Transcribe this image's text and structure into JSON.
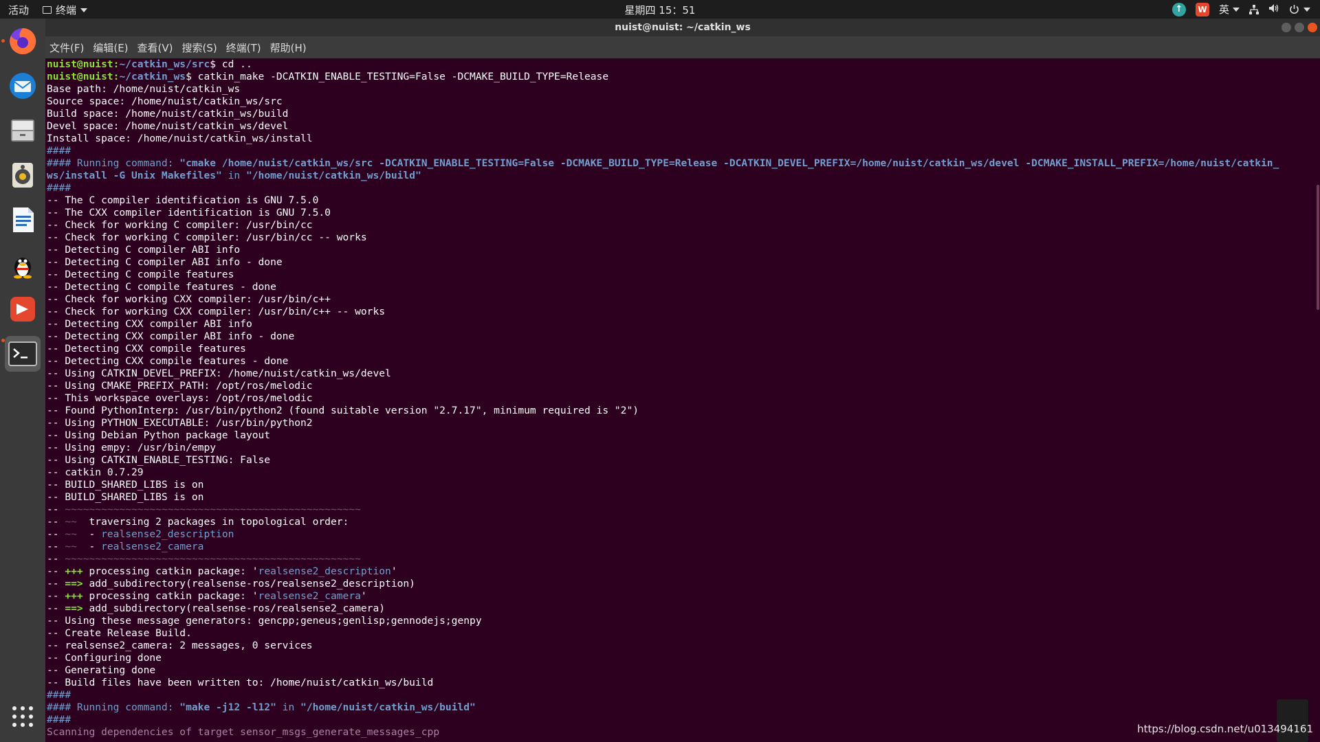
{
  "topbar": {
    "activities": "活动",
    "app_name": "终端",
    "clock": "星期四 15：51",
    "input_method": "英"
  },
  "window": {
    "title": "nuist@nuist: ~/catkin_ws"
  },
  "menu": [
    "文件(F)",
    "编辑(E)",
    "查看(V)",
    "搜索(S)",
    "终端(T)",
    "帮助(H)"
  ],
  "dock": {
    "items": [
      "firefox-icon",
      "thunderbird-icon",
      "files-icon",
      "rhythmbox-icon",
      "libreoffice-writer-icon",
      "qq-icon",
      "wps-icon",
      "terminal-icon"
    ],
    "show_apps": "show-applications-icon"
  },
  "terminal": {
    "lines": [
      [
        {
          "t": "nuist@nuist:",
          "c": "g"
        },
        {
          "t": "~/catkin_ws/src",
          "c": "b"
        },
        {
          "t": "$ cd ..",
          "c": ""
        }
      ],
      [
        {
          "t": "nuist@nuist:",
          "c": "g"
        },
        {
          "t": "~/catkin_ws",
          "c": "b"
        },
        {
          "t": "$ catkin_make -DCATKIN_ENABLE_TESTING=False -DCMAKE_BUILD_TYPE=Release",
          "c": ""
        }
      ],
      [
        {
          "t": "Base path: /home/nuist/catkin_ws",
          "c": ""
        }
      ],
      [
        {
          "t": "Source space: /home/nuist/catkin_ws/src",
          "c": ""
        }
      ],
      [
        {
          "t": "Build space: /home/nuist/catkin_ws/build",
          "c": ""
        }
      ],
      [
        {
          "t": "Devel space: /home/nuist/catkin_ws/devel",
          "c": ""
        }
      ],
      [
        {
          "t": "Install space: /home/nuist/catkin_ws/install",
          "c": ""
        }
      ],
      [
        {
          "t": "####",
          "c": "bp"
        }
      ],
      [
        {
          "t": "#### Running command: ",
          "c": "bp"
        },
        {
          "t": "\"cmake /home/nuist/catkin_ws/src -DCATKIN_ENABLE_TESTING=False -DCMAKE_BUILD_TYPE=Release -DCATKIN_DEVEL_PREFIX=/home/nuist/catkin_ws/devel -DCMAKE_INSTALL_PREFIX=/home/nuist/catkin_",
          "c": "bb"
        }
      ],
      [
        {
          "t": "ws/install -G Unix Makefiles\"",
          "c": "bb"
        },
        {
          "t": " in ",
          "c": "bp"
        },
        {
          "t": "\"/home/nuist/catkin_ws/build\"",
          "c": "bb"
        }
      ],
      [
        {
          "t": "####",
          "c": "bp"
        }
      ],
      [
        {
          "t": "-- The C compiler identification is GNU 7.5.0",
          "c": ""
        }
      ],
      [
        {
          "t": "-- The CXX compiler identification is GNU 7.5.0",
          "c": ""
        }
      ],
      [
        {
          "t": "-- Check for working C compiler: /usr/bin/cc",
          "c": ""
        }
      ],
      [
        {
          "t": "-- Check for working C compiler: /usr/bin/cc -- works",
          "c": ""
        }
      ],
      [
        {
          "t": "-- Detecting C compiler ABI info",
          "c": ""
        }
      ],
      [
        {
          "t": "-- Detecting C compiler ABI info - done",
          "c": ""
        }
      ],
      [
        {
          "t": "-- Detecting C compile features",
          "c": ""
        }
      ],
      [
        {
          "t": "-- Detecting C compile features - done",
          "c": ""
        }
      ],
      [
        {
          "t": "-- Check for working CXX compiler: /usr/bin/c++",
          "c": ""
        }
      ],
      [
        {
          "t": "-- Check for working CXX compiler: /usr/bin/c++ -- works",
          "c": ""
        }
      ],
      [
        {
          "t": "-- Detecting CXX compiler ABI info",
          "c": ""
        }
      ],
      [
        {
          "t": "-- Detecting CXX compiler ABI info - done",
          "c": ""
        }
      ],
      [
        {
          "t": "-- Detecting CXX compile features",
          "c": ""
        }
      ],
      [
        {
          "t": "-- Detecting CXX compile features - done",
          "c": ""
        }
      ],
      [
        {
          "t": "-- Using CATKIN_DEVEL_PREFIX: /home/nuist/catkin_ws/devel",
          "c": ""
        }
      ],
      [
        {
          "t": "-- Using CMAKE_PREFIX_PATH: /opt/ros/melodic",
          "c": ""
        }
      ],
      [
        {
          "t": "-- This workspace overlays: /opt/ros/melodic",
          "c": ""
        }
      ],
      [
        {
          "t": "-- Found PythonInterp: /usr/bin/python2 (found suitable version \"2.7.17\", minimum required is \"2\")",
          "c": ""
        }
      ],
      [
        {
          "t": "-- Using PYTHON_EXECUTABLE: /usr/bin/python2",
          "c": ""
        }
      ],
      [
        {
          "t": "-- Using Debian Python package layout",
          "c": ""
        }
      ],
      [
        {
          "t": "-- Using empy: /usr/bin/empy",
          "c": ""
        }
      ],
      [
        {
          "t": "-- Using CATKIN_ENABLE_TESTING: False",
          "c": ""
        }
      ],
      [
        {
          "t": "-- catkin 0.7.29",
          "c": ""
        }
      ],
      [
        {
          "t": "-- BUILD_SHARED_LIBS is on",
          "c": ""
        }
      ],
      [
        {
          "t": "-- BUILD_SHARED_LIBS is on",
          "c": ""
        }
      ],
      [
        {
          "t": "-- ",
          "c": ""
        },
        {
          "t": "~~~~~~~~~~~~~~~~~~~~~~~~~~~~~~~~~~~~~~~~~~~~~~~~~",
          "c": "gy"
        }
      ],
      [
        {
          "t": "-- ",
          "c": ""
        },
        {
          "t": "~~",
          "c": "gy"
        },
        {
          "t": "  traversing 2 packages in topological order:",
          "c": ""
        }
      ],
      [
        {
          "t": "-- ",
          "c": ""
        },
        {
          "t": "~~",
          "c": "gy"
        },
        {
          "t": "  - ",
          "c": ""
        },
        {
          "t": "realsense2_description",
          "c": "bp"
        }
      ],
      [
        {
          "t": "-- ",
          "c": ""
        },
        {
          "t": "~~",
          "c": "gy"
        },
        {
          "t": "  - ",
          "c": ""
        },
        {
          "t": "realsense2_camera",
          "c": "bp"
        }
      ],
      [
        {
          "t": "-- ",
          "c": ""
        },
        {
          "t": "~~~~~~~~~~~~~~~~~~~~~~~~~~~~~~~~~~~~~~~~~~~~~~~~~",
          "c": "gy"
        }
      ],
      [
        {
          "t": "-- ",
          "c": ""
        },
        {
          "t": "+++",
          "c": "g"
        },
        {
          "t": " processing catkin package: '",
          "c": ""
        },
        {
          "t": "realsense2_description",
          "c": "bp"
        },
        {
          "t": "'",
          "c": ""
        }
      ],
      [
        {
          "t": "-- ",
          "c": ""
        },
        {
          "t": "==>",
          "c": "g"
        },
        {
          "t": " add_subdirectory(realsense-ros/realsense2_description)",
          "c": ""
        }
      ],
      [
        {
          "t": "-- ",
          "c": ""
        },
        {
          "t": "+++",
          "c": "g"
        },
        {
          "t": " processing catkin package: '",
          "c": ""
        },
        {
          "t": "realsense2_camera",
          "c": "bp"
        },
        {
          "t": "'",
          "c": ""
        }
      ],
      [
        {
          "t": "-- ",
          "c": ""
        },
        {
          "t": "==>",
          "c": "g"
        },
        {
          "t": " add_subdirectory(realsense-ros/realsense2_camera)",
          "c": ""
        }
      ],
      [
        {
          "t": "-- Using these message generators: gencpp;geneus;genlisp;gennodejs;genpy",
          "c": ""
        }
      ],
      [
        {
          "t": "-- Create Release Build.",
          "c": ""
        }
      ],
      [
        {
          "t": "-- realsense2_camera: 2 messages, 0 services",
          "c": ""
        }
      ],
      [
        {
          "t": "-- Configuring done",
          "c": ""
        }
      ],
      [
        {
          "t": "-- Generating done",
          "c": ""
        }
      ],
      [
        {
          "t": "-- Build files have been written to: /home/nuist/catkin_ws/build",
          "c": ""
        }
      ],
      [
        {
          "t": "####",
          "c": "bp"
        }
      ],
      [
        {
          "t": "#### Running command: ",
          "c": "bp"
        },
        {
          "t": "\"make -j12 -l12\"",
          "c": "bb"
        },
        {
          "t": " in ",
          "c": "bp"
        },
        {
          "t": "\"/home/nuist/catkin_ws/build\"",
          "c": "bb"
        }
      ],
      [
        {
          "t": "####",
          "c": "bp"
        }
      ],
      [
        {
          "t": "Scanning dependencies of target sensor_msgs_generate_messages_cpp",
          "c": "mg"
        }
      ]
    ]
  },
  "watermark": "https://blog.csdn.net/u013494161"
}
